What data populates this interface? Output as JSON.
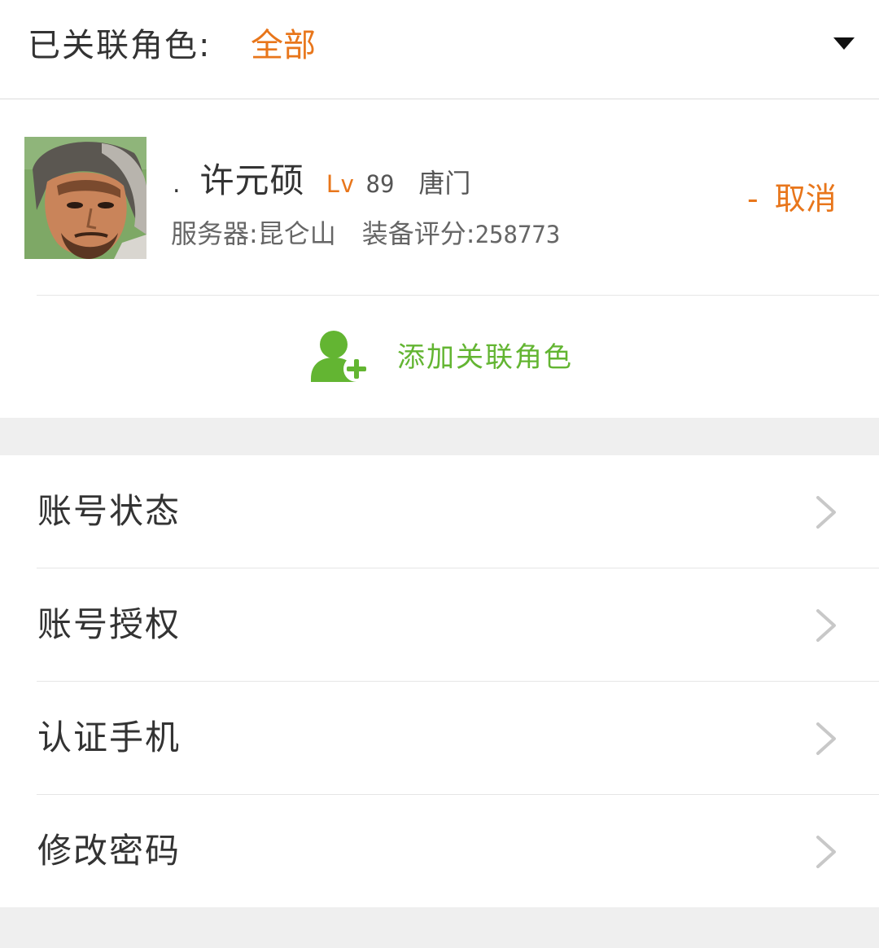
{
  "filter": {
    "label": "已关联角色:",
    "value": "全部",
    "dropdown_icon": "chevron-down-icon"
  },
  "character": {
    "prefix": ".",
    "name": "许元硕",
    "lv_label": "Lv",
    "level": "89",
    "class": "唐门",
    "server": "服务器:昆仑山",
    "score_label": "装备评分:",
    "score": "258773",
    "cancel_prefix": "-",
    "cancel_label": "取消"
  },
  "add_role": {
    "label": "添加关联角色",
    "icon": "add-user-icon"
  },
  "menu": {
    "items": [
      {
        "label": "账号状态"
      },
      {
        "label": "账号授权"
      },
      {
        "label": "认证手机"
      },
      {
        "label": "修改密码"
      }
    ]
  },
  "colors": {
    "accent_orange": "#e8761b",
    "accent_green": "#63b532",
    "background": "#efefef",
    "text": "#333333"
  }
}
